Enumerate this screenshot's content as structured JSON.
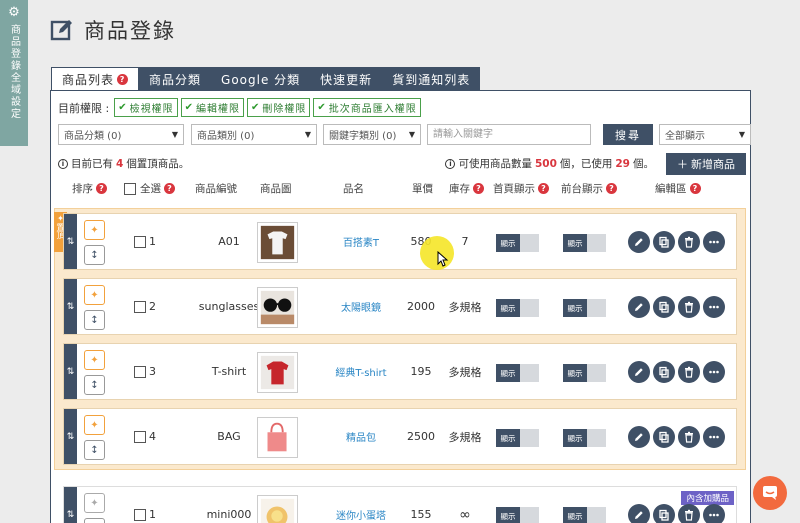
{
  "sidebar": {
    "label": "商品登錄全域設定"
  },
  "page": {
    "title": "商品登錄"
  },
  "tabs": [
    {
      "label": "商品列表"
    },
    {
      "label": "商品分類"
    },
    {
      "label": "Google 分類"
    },
    {
      "label": "快速更新"
    },
    {
      "label": "貨到通知列表"
    }
  ],
  "permissions": {
    "label": "目前權限 :",
    "items": [
      "檢視權限",
      "編輯權限",
      "刪除權限",
      "批次商品匯入權限"
    ]
  },
  "filters": {
    "category": "商品分類 (0)",
    "type": "商品類別 (0)",
    "keyword_type": "關鍵字類別 (0)",
    "keyword_placeholder": "請輸入關鍵字",
    "search": "搜尋",
    "display": "全部顯示"
  },
  "info": {
    "pinned_prefix": "目前已有",
    "pinned_count": "4",
    "pinned_suffix": "個置頂商品。",
    "quota_prefix": "可使用商品數量",
    "quota_total": "500",
    "quota_mid": "個，已使用",
    "quota_used": "29",
    "quota_suffix": "個。",
    "add_button": "新增商品"
  },
  "columns": {
    "sort": "排序",
    "select_all": "全選",
    "code": "商品編號",
    "image": "商品圖",
    "name": "品名",
    "price": "單價",
    "stock": "庫存",
    "home_display": "首頁顯示",
    "front_display": "前台顯示",
    "edit": "編輯區"
  },
  "pin_flag": "置頂",
  "toggle_label": "顯示",
  "rows": [
    {
      "index": "1",
      "code": "A01",
      "name": "百搭素T",
      "price": "580",
      "stock": "7"
    },
    {
      "index": "2",
      "code": "sunglasses",
      "name": "太陽眼鏡",
      "price": "2000",
      "stock": "多規格"
    },
    {
      "index": "3",
      "code": "T-shirt",
      "name": "經典T-shirt",
      "price": "195",
      "stock": "多規格"
    },
    {
      "index": "4",
      "code": "BAG",
      "name": "精品包",
      "price": "2500",
      "stock": "多規格"
    },
    {
      "index": "1",
      "code": "mini000",
      "name": "迷你小蛋塔",
      "price": "155",
      "stock": "∞",
      "badge": "內含加購品"
    }
  ],
  "colors": {
    "navy": "#3f5066",
    "pinned_bg": "#fbe9cd",
    "accent_red": "#d9363e",
    "chat": "#f26a3e"
  }
}
